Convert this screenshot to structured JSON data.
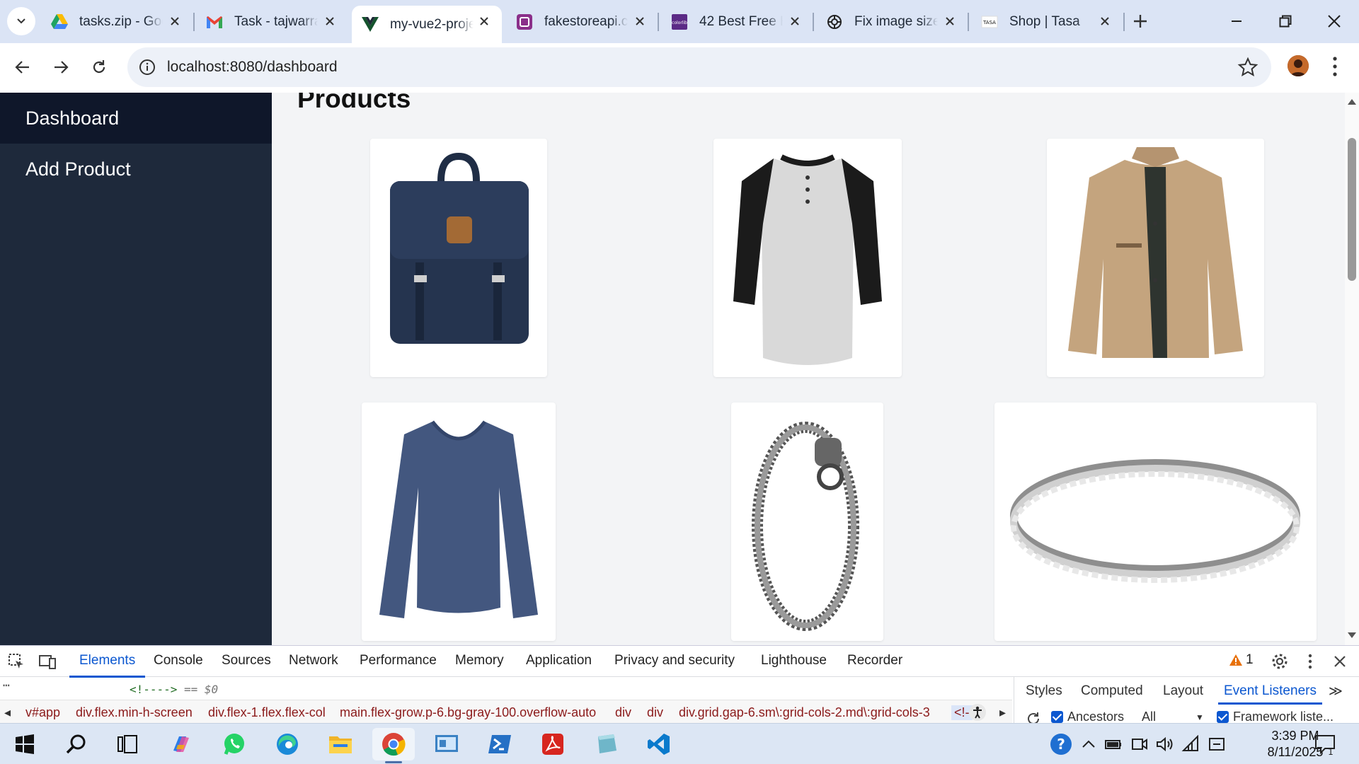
{
  "browser": {
    "tabs": [
      {
        "title": "tasks.zip - Goo",
        "icon": "google-drive-icon",
        "active": false
      },
      {
        "title": "Task - tajwarra",
        "icon": "gmail-icon",
        "active": false
      },
      {
        "title": "my-vue2-proje",
        "icon": "vue-icon",
        "active": true
      },
      {
        "title": "fakestoreapi.co",
        "icon": "fakestore-icon",
        "active": false
      },
      {
        "title": "42 Best Free H",
        "icon": "colorlib-icon",
        "active": false
      },
      {
        "title": "Fix image size",
        "icon": "openai-icon",
        "active": false
      },
      {
        "title": "Shop | Tasa",
        "icon": "tasa-icon",
        "active": false
      }
    ],
    "url": "localhost:8080/dashboard"
  },
  "sidebar": {
    "items": [
      {
        "label": "Dashboard",
        "active": true
      },
      {
        "label": "Add Product",
        "active": false
      }
    ]
  },
  "main": {
    "title": "Products",
    "products": [
      {
        "image": "navy-backpack"
      },
      {
        "image": "raglan-henley-shirt"
      },
      {
        "image": "tan-jacket"
      },
      {
        "image": "blue-long-sleeve-tee"
      },
      {
        "image": "silver-dragon-bracelet"
      },
      {
        "image": "silver-diamond-ring"
      }
    ]
  },
  "devtools": {
    "tabs": [
      "Elements",
      "Console",
      "Sources",
      "Network",
      "Performance",
      "Memory",
      "Application",
      "Privacy and security",
      "Lighthouse",
      "Recorder"
    ],
    "active_tab": "Elements",
    "warning_count": "1",
    "selected_line": "<!---->",
    "selected_suffix": "== $0",
    "breadcrumbs": [
      "v#app",
      "div.flex.min-h-screen",
      "div.flex-1.flex.flex-col",
      "main.flex-grow.p-6.bg-gray-100.overflow-auto",
      "div",
      "div",
      "div.grid.gap-6.sm\\:grid-cols-2.md\\:grid-cols-3",
      "<!-"
    ],
    "side_tabs": [
      "Styles",
      "Computed",
      "Layout",
      "Event Listeners"
    ],
    "side_active": "Event Listeners",
    "filter_ancestors": "Ancestors",
    "filter_all": "All",
    "filter_framework": "Framework liste..."
  },
  "taskbar": {
    "time": "3:39 PM",
    "date": "8/11/2025",
    "notification_count": "1"
  },
  "colors": {
    "sidebar_bg": "#1e293b",
    "sidebar_active": "#0f172a",
    "content_bg": "#f3f4f6",
    "accent": "#0b57d0"
  }
}
